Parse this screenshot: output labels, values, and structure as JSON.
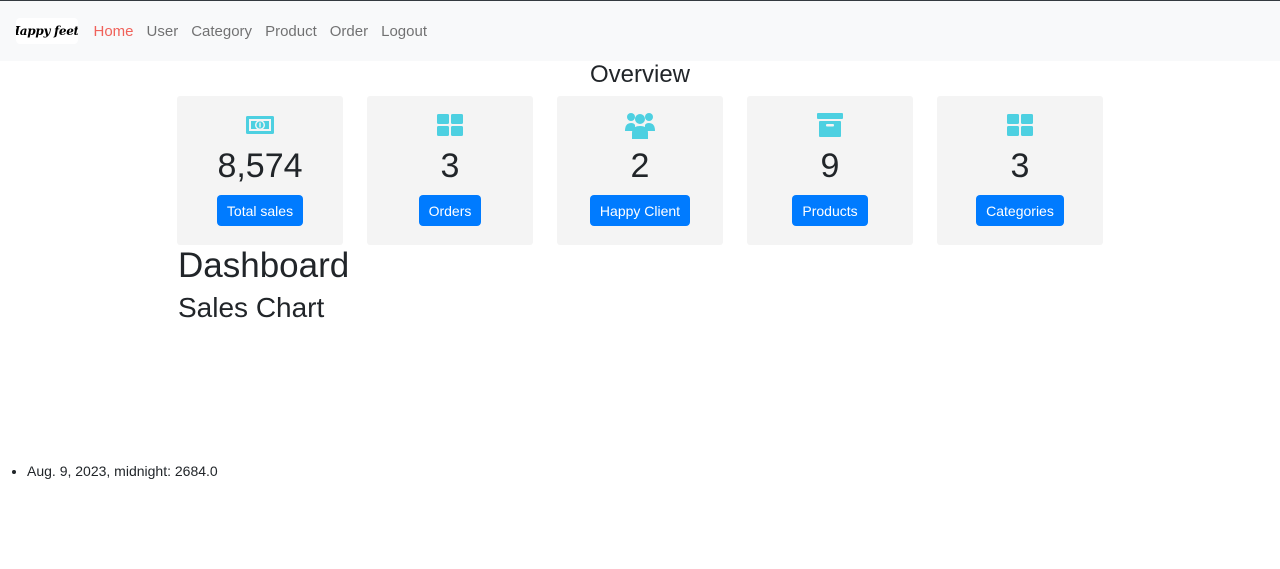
{
  "brand": {
    "text": "Happy feets"
  },
  "nav": {
    "home": "Home",
    "user": "User",
    "category": "Category",
    "product": "Product",
    "order": "Order",
    "logout": "Logout",
    "active_color": "#f0625a"
  },
  "overview": {
    "title": "Overview",
    "cards": [
      {
        "icon": "money-bill-icon",
        "value": "8,574",
        "button": "Total sales"
      },
      {
        "icon": "grid-icon",
        "value": "3",
        "button": "Orders"
      },
      {
        "icon": "users-icon",
        "value": "2",
        "button": "Happy Client"
      },
      {
        "icon": "archive-box-icon",
        "value": "9",
        "button": "Products"
      },
      {
        "icon": "grid-icon",
        "value": "3",
        "button": "Categories"
      }
    ],
    "icon_color": "#4dd0e1",
    "button_color": "#007bff"
  },
  "dashboard": {
    "title": "Dashboard",
    "sales_chart_title": "Sales Chart",
    "sales": [
      "Aug. 9, 2023, midnight: 2684.0"
    ]
  }
}
